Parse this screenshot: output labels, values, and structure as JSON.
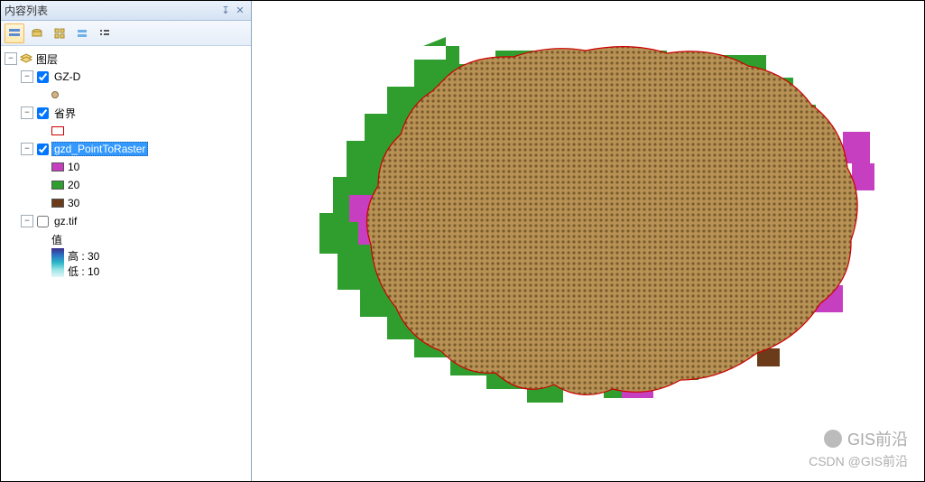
{
  "panel": {
    "title": "内容列表"
  },
  "tree": {
    "root": {
      "label": "图层"
    },
    "layer1": {
      "label": "GZ-D",
      "checked": true
    },
    "layer2": {
      "label": "省界",
      "checked": true
    },
    "layer3": {
      "label": "gzd_PointToRaster",
      "checked": true,
      "classes": [
        {
          "label": "10",
          "color": "#c63fc0"
        },
        {
          "label": "20",
          "color": "#2f9e2f"
        },
        {
          "label": "30",
          "color": "#6b3b1a"
        }
      ]
    },
    "layer4": {
      "label": "gz.tif",
      "checked": false,
      "value_label": "值",
      "high_label": "高 : 30",
      "low_label": "低 : 10"
    }
  },
  "watermark": {
    "line1": "GIS前沿",
    "line2": "CSDN @GIS前沿"
  }
}
